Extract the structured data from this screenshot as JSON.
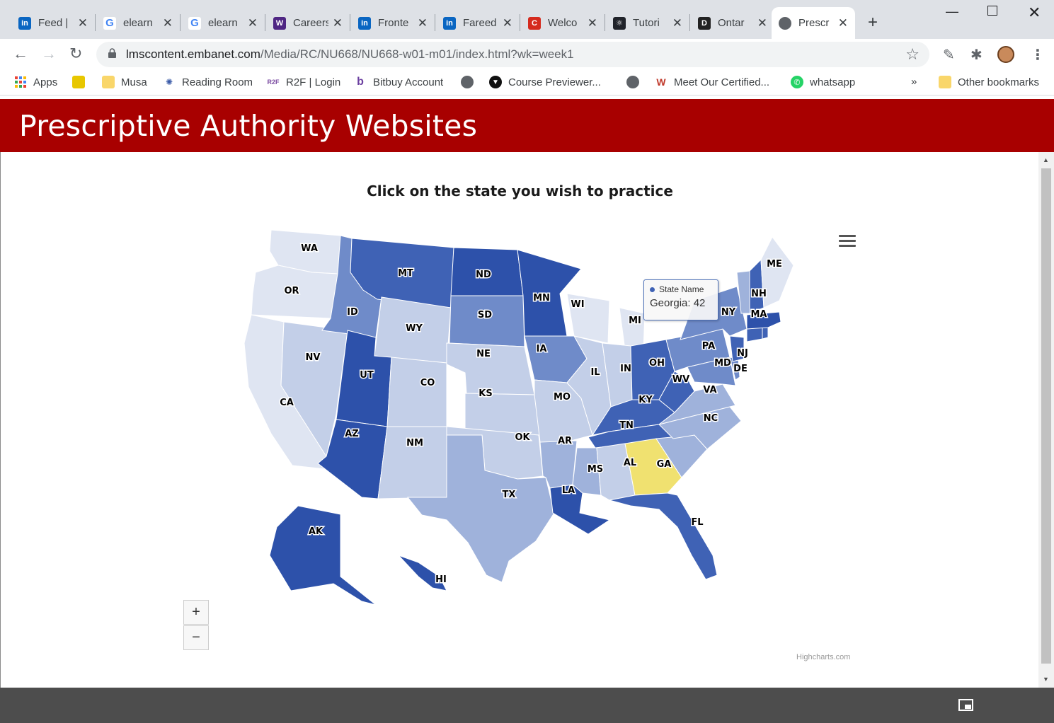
{
  "browser": {
    "tabs": [
      {
        "label": "Feed |",
        "icon": "linkedin-icon"
      },
      {
        "label": "elearn",
        "icon": "google-icon"
      },
      {
        "label": "elearn",
        "icon": "google-icon"
      },
      {
        "label": "Careers",
        "icon": "western-icon"
      },
      {
        "label": "Fronte",
        "icon": "linkedin-icon"
      },
      {
        "label": "Fareed",
        "icon": "linkedin-icon"
      },
      {
        "label": "Welco",
        "icon": "c-icon"
      },
      {
        "label": "Tutori",
        "icon": "react-icon"
      },
      {
        "label": "Ontar",
        "icon": "dms-icon"
      },
      {
        "label": "Prescr",
        "icon": "globe-icon"
      }
    ],
    "url_domain": "lmscontent.embanet.com",
    "url_path": "/Media/RC/NU668/NU668-w01-m01/index.html?wk=week1",
    "bookmarks": [
      "Apps",
      "",
      "Musa",
      "Reading Room",
      "R2F | Login",
      "Bitbuy Account",
      "",
      "Course Previewer...",
      "",
      "Meet Our Certified...",
      "whatsapp"
    ],
    "other_bookmarks": "Other bookmarks",
    "more": "»"
  },
  "page": {
    "title": "Prescriptive Authority Websites",
    "chart_title": "Click on the state you wish to practice",
    "zoom_in": "+",
    "zoom_out": "−",
    "credits": "Highcharts.com"
  },
  "tooltip": {
    "series": "State Name",
    "label": "Georgia: 42"
  },
  "chart_data": {
    "type": "map",
    "title": "Click on the state you wish to practice",
    "highlighted": "GA",
    "highlight_color": "#f0e170",
    "states": [
      {
        "code": "WA",
        "shade": 1
      },
      {
        "code": "OR",
        "shade": 1
      },
      {
        "code": "CA",
        "shade": 1
      },
      {
        "code": "NV",
        "shade": 2
      },
      {
        "code": "ID",
        "shade": 4
      },
      {
        "code": "MT",
        "shade": 5
      },
      {
        "code": "WY",
        "shade": 2
      },
      {
        "code": "UT",
        "shade": 6
      },
      {
        "code": "CO",
        "shade": 2
      },
      {
        "code": "AZ",
        "shade": 6
      },
      {
        "code": "NM",
        "shade": 2
      },
      {
        "code": "ND",
        "shade": 6
      },
      {
        "code": "SD",
        "shade": 4
      },
      {
        "code": "NE",
        "shade": 2
      },
      {
        "code": "KS",
        "shade": 2
      },
      {
        "code": "OK",
        "shade": 2
      },
      {
        "code": "TX",
        "shade": 3
      },
      {
        "code": "MN",
        "shade": 6
      },
      {
        "code": "IA",
        "shade": 4
      },
      {
        "code": "MO",
        "shade": 2
      },
      {
        "code": "AR",
        "shade": 3
      },
      {
        "code": "LA",
        "shade": 6
      },
      {
        "code": "WI",
        "shade": 1
      },
      {
        "code": "IL",
        "shade": 2
      },
      {
        "code": "MI",
        "shade": 1
      },
      {
        "code": "IN",
        "shade": 2
      },
      {
        "code": "OH",
        "shade": 5
      },
      {
        "code": "KY",
        "shade": 5
      },
      {
        "code": "TN",
        "shade": 5
      },
      {
        "code": "MS",
        "shade": 3
      },
      {
        "code": "AL",
        "shade": 2
      },
      {
        "code": "GA",
        "shade": 0
      },
      {
        "code": "FL",
        "shade": 5
      },
      {
        "code": "SC",
        "shade": 3
      },
      {
        "code": "NC",
        "shade": 3
      },
      {
        "code": "VA",
        "shade": 3
      },
      {
        "code": "WV",
        "shade": 5
      },
      {
        "code": "PA",
        "shade": 4
      },
      {
        "code": "NY",
        "shade": 4
      },
      {
        "code": "MD",
        "shade": 4
      },
      {
        "code": "DE",
        "shade": 4
      },
      {
        "code": "NJ",
        "shade": 5
      },
      {
        "code": "CT",
        "shade": 5
      },
      {
        "code": "RI",
        "shade": 5
      },
      {
        "code": "MA",
        "shade": 6
      },
      {
        "code": "VT",
        "shade": 3
      },
      {
        "code": "NH",
        "shade": 5
      },
      {
        "code": "ME",
        "shade": 1
      },
      {
        "code": "AK",
        "shade": 6
      },
      {
        "code": "HI",
        "shade": 6
      }
    ],
    "palette": [
      "#f0e170",
      "#dfe5f2",
      "#c3cfe8",
      "#9fb2db",
      "#6f8bc9",
      "#3f62b5",
      "#2d51aa"
    ]
  }
}
